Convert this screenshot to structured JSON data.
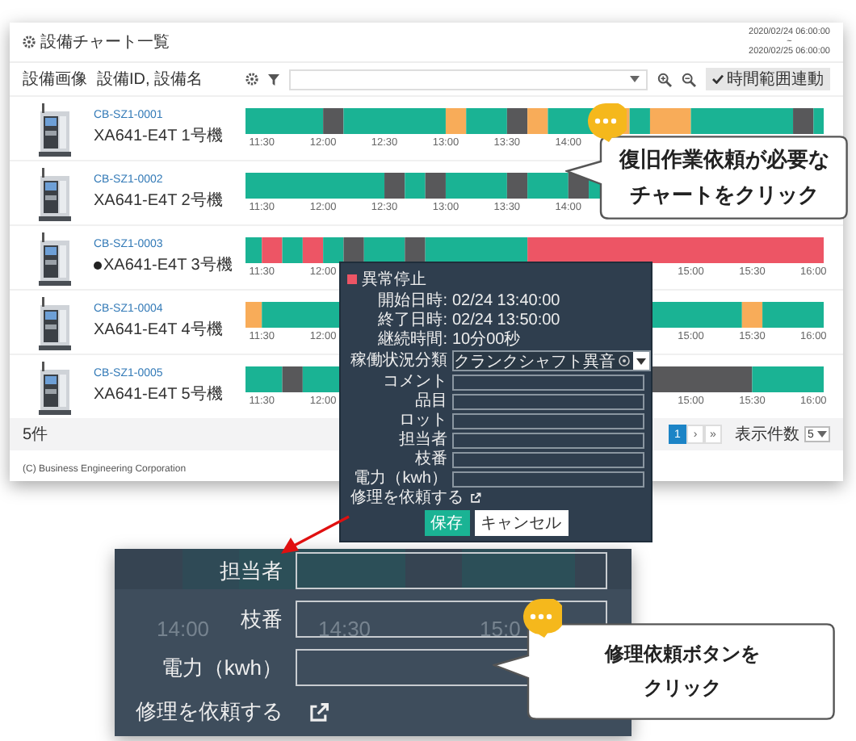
{
  "header": {
    "title": "設備チャート一覧",
    "period_start": "2020/02/24 06:00:00",
    "period_separator": "~",
    "period_end": "2020/02/25 06:00:00"
  },
  "toolbar": {
    "image_column": "設備画像",
    "id_column": "設備ID, 設備名",
    "range_link_button": {
      "label": "時間範囲連動",
      "checked": true
    }
  },
  "machines": [
    {
      "id": "CB-SZ1-0001",
      "name": "XA641-E4T 1号機",
      "alert": false,
      "ticks": [
        "11:30",
        "12:00",
        "12:30",
        "13:00",
        "13:30",
        "14:00"
      ]
    },
    {
      "id": "CB-SZ1-0002",
      "name": "XA641-E4T 2号機",
      "alert": false,
      "ticks": [
        "11:30",
        "12:00",
        "12:30",
        "13:00",
        "13:30",
        "14:00"
      ]
    },
    {
      "id": "CB-SZ1-0003",
      "name": "XA641-E4T 3号機",
      "alert": true,
      "ticks": [
        "11:30",
        "12:00"
      ],
      "end_ticks": [
        "15:00",
        "15:30",
        "16:00"
      ]
    },
    {
      "id": "CB-SZ1-0004",
      "name": "XA641-E4T 4号機",
      "alert": false,
      "ticks": [
        "11:30",
        "12:00"
      ],
      "end_ticks": [
        "15:00",
        "15:30",
        "16:00"
      ]
    },
    {
      "id": "CB-SZ1-0005",
      "name": "XA641-E4T 5号機",
      "alert": false,
      "ticks": [
        "11:30",
        "12:00"
      ],
      "end_ticks": [
        "15:00",
        "15:30",
        "16:00"
      ]
    }
  ],
  "footer": {
    "count": "5件",
    "pagination": [
      {
        "label": "1",
        "selected": true
      },
      {
        "label": "›",
        "selected": false
      },
      {
        "label": "»",
        "selected": false
      }
    ],
    "page_size_label": "表示件数",
    "page_size": "5"
  },
  "copyright": "(C) Business Engineering Corporation",
  "popup": {
    "status": "異常停止",
    "info": [
      {
        "label": "開始日時:",
        "value": "02/24 13:40:00"
      },
      {
        "label": "終了日時:",
        "value": "02/24 13:50:00"
      },
      {
        "label": "継続時間:",
        "value": "10分00秒"
      }
    ],
    "category": {
      "label": "稼働状況分類",
      "value": "クランクシャフト異音"
    },
    "fields": [
      {
        "label": "コメント"
      },
      {
        "label": "品目"
      },
      {
        "label": "ロット"
      },
      {
        "label": "担当者"
      },
      {
        "label": "枝番"
      },
      {
        "label": "電力（kwh）"
      }
    ],
    "repair_link": "修理を依頼する",
    "save": "保存",
    "cancel": "キャンセル"
  },
  "inset": {
    "ticks": [
      "14:00",
      "14:30",
      "15:0"
    ],
    "fields": [
      {
        "label": "担当者"
      },
      {
        "label": "枝番"
      },
      {
        "label": "電力（kwh）"
      }
    ],
    "repair_link": "修理を依頼する"
  },
  "callouts": [
    {
      "lines": [
        "復旧作業依頼が必要な",
        "チャートをクリック"
      ]
    },
    {
      "lines": [
        "修理依頼ボタンを",
        "クリック"
      ]
    }
  ]
}
